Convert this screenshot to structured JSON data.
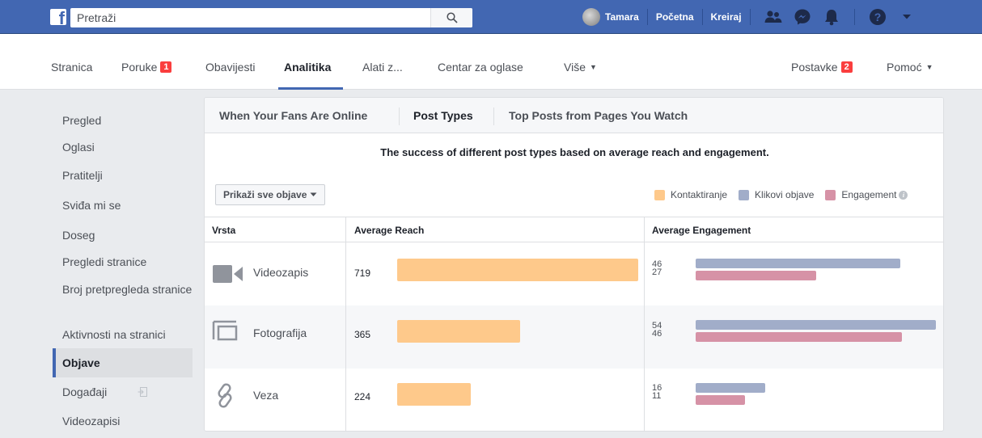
{
  "topbar": {
    "search_placeholder": "Pretraži",
    "user_name": "Tamara",
    "home_label": "Početna",
    "create_label": "Kreiraj"
  },
  "subnav": {
    "page": "Stranica",
    "messages": "Poruke",
    "messages_badge": "1",
    "notifications": "Obavijesti",
    "insights": "Analitika",
    "tools": "Alati z...",
    "ad_center": "Centar za oglase",
    "more": "Više",
    "settings": "Postavke",
    "settings_badge": "2",
    "help": "Pomoć"
  },
  "sidebar": {
    "items": [
      {
        "label": "Pregled"
      },
      {
        "label": "Oglasi"
      },
      {
        "label": "Pratitelji"
      },
      {
        "label": "Sviđa mi se"
      },
      {
        "label": "Doseg"
      },
      {
        "label": "Pregledi stranice"
      },
      {
        "label": "Broj pretpregleda stranice"
      },
      {
        "label": "Aktivnosti na stranici"
      },
      {
        "label": "Objave"
      },
      {
        "label": "Događaji"
      },
      {
        "label": "Videozapisi"
      }
    ],
    "active": "Objave"
  },
  "panel": {
    "tabs": [
      {
        "label": "When Your Fans Are Online"
      },
      {
        "label": "Post Types"
      },
      {
        "label": "Top Posts from Pages You Watch"
      }
    ],
    "active_tab": "Post Types",
    "subtitle": "The success of different post types based on average reach and engagement.",
    "filter_label": "Prikaži sve objave",
    "legend": [
      {
        "label": "Kontaktiranje",
        "color": "#fec98b"
      },
      {
        "label": "Klikovi objave",
        "color": "#a1adc9"
      },
      {
        "label": "Engagement",
        "color": "#d692a6"
      }
    ],
    "columns": {
      "type": "Vrsta",
      "reach": "Average Reach",
      "engagement": "Average Engagement"
    },
    "rows": [
      {
        "type": "Videozapis",
        "icon": "video-camera-icon",
        "reach": "719",
        "clicks": "46",
        "engagement": "27"
      },
      {
        "type": "Fotografija",
        "icon": "photo-icon",
        "reach": "365",
        "clicks": "54",
        "engagement": "46"
      },
      {
        "type": "Veza",
        "icon": "link-icon",
        "reach": "224",
        "clicks": "16",
        "engagement": "11"
      }
    ]
  },
  "colors": {
    "brand": "#4267b2",
    "reach_bar": "#fec98b",
    "clicks_bar": "#a1adc9",
    "engagement_bar": "#d692a6",
    "badge": "#fa3e3e"
  }
}
